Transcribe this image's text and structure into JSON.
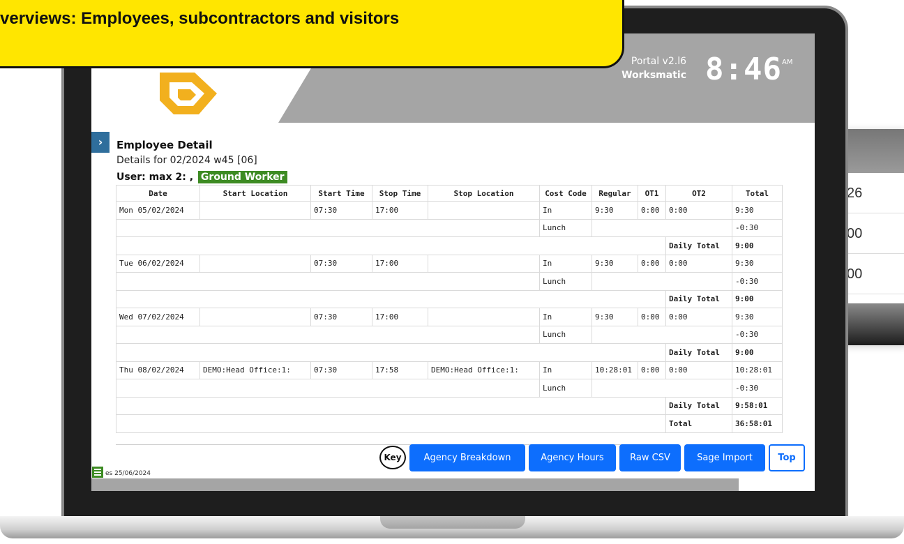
{
  "banner": {
    "text": "ve overviews: Employees, subcontractors and visitors"
  },
  "header": {
    "portal_version": "Portal v2.l6",
    "company": "Worksmatic",
    "clock": "8:46",
    "ampm": "AM"
  },
  "page": {
    "expand_glyph": "›",
    "title": "Employee Detail",
    "details": "Details for 02/2024 w45 [06]",
    "user_label": "User: max 2: ,",
    "role": "Ground Worker",
    "role_color": "#3d8b23"
  },
  "table": {
    "headers": [
      "Date",
      "Start Location",
      "Start Time",
      "Stop Time",
      "Stop Location",
      "Cost Code",
      "Regular",
      "OT1",
      "OT2",
      "Total"
    ],
    "rows": [
      {
        "kind": "entry",
        "cells": [
          "Mon 05/02/2024",
          "",
          "07:30",
          "17:00",
          "",
          "In",
          "9:30",
          "0:00",
          "0:00",
          "9:30"
        ]
      },
      {
        "kind": "lunch",
        "code": "Lunch",
        "total": "-0:30"
      },
      {
        "kind": "daily",
        "label": "Daily Total",
        "total": "9:00"
      },
      {
        "kind": "entry",
        "cells": [
          "Tue 06/02/2024",
          "",
          "07:30",
          "17:00",
          "",
          "In",
          "9:30",
          "0:00",
          "0:00",
          "9:30"
        ]
      },
      {
        "kind": "lunch",
        "code": "Lunch",
        "total": "-0:30"
      },
      {
        "kind": "daily",
        "label": "Daily Total",
        "total": "9:00"
      },
      {
        "kind": "entry",
        "cells": [
          "Wed 07/02/2024",
          "",
          "07:30",
          "17:00",
          "",
          "In",
          "9:30",
          "0:00",
          "0:00",
          "9:30"
        ]
      },
      {
        "kind": "lunch",
        "code": "Lunch",
        "total": "-0:30"
      },
      {
        "kind": "daily",
        "label": "Daily Total",
        "total": "9:00"
      },
      {
        "kind": "entry",
        "cells": [
          "Thu 08/02/2024",
          "DEMO:Head Office:1:",
          "07:30",
          "17:58",
          "DEMO:Head Office:1:",
          "In",
          "10:28:01",
          "0:00",
          "0:00",
          "10:28:01"
        ]
      },
      {
        "kind": "lunch",
        "code": "Lunch",
        "total": "-0:30"
      },
      {
        "kind": "daily",
        "label": "Daily Total",
        "total": "9:58:01"
      },
      {
        "kind": "grand",
        "label": "Total",
        "total": "36:58:01"
      }
    ]
  },
  "buttons": {
    "key": "Key",
    "agency_breakdown": "Agency Breakdown",
    "agency_hours": "Agency Hours",
    "raw_csv": "Raw CSV",
    "sage_import": "Sage Import",
    "top": "Top"
  },
  "footer": {
    "date": "es 25/06/2024"
  },
  "background_widget": {
    "rows": [
      "26",
      "00",
      "00"
    ]
  },
  "colors": {
    "banner": "#ffe600",
    "primary_button": "#0d6efd",
    "header_gray": "#a5a5a5",
    "logo": "#f2b01e"
  }
}
